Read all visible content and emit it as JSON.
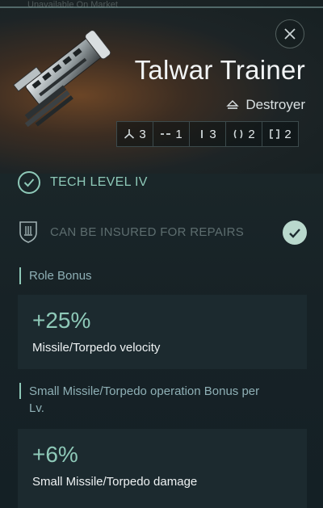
{
  "header": {
    "faded_text": "Unavailable On Market",
    "title": "Talwar Trainer",
    "ship_class": "Destroyer"
  },
  "slots": [
    {
      "icon": "turret-hardpoint-icon",
      "value": "3"
    },
    {
      "icon": "launcher-hardpoint-icon",
      "value": "1"
    },
    {
      "icon": "high-slot-icon",
      "value": "3"
    },
    {
      "icon": "mid-slot-icon",
      "value": "2"
    },
    {
      "icon": "low-slot-icon",
      "value": "2"
    }
  ],
  "tech": {
    "label": "TECH LEVEL IV"
  },
  "insurance": {
    "label": "CAN BE INSURED FOR REPAIRS"
  },
  "bonuses": [
    {
      "section": "Role Bonus",
      "value": "+25%",
      "description": "Missile/Torpedo velocity"
    },
    {
      "section": "Small Missile/Torpedo operation Bonus per Lv.",
      "value": "+6%",
      "description": "Small Missile/Torpedo damage"
    }
  ],
  "colors": {
    "accent": "#8ec9b8",
    "title": "#f2f5f6",
    "muted": "#5d6d6f"
  }
}
